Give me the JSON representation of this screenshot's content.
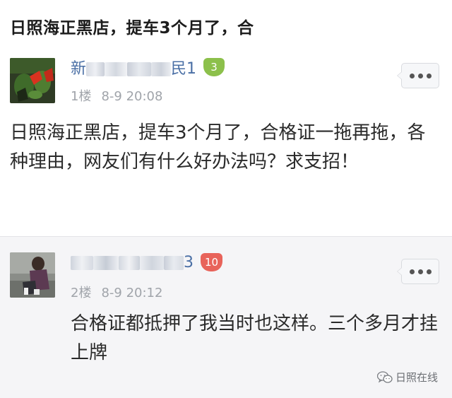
{
  "thread": {
    "title": "日照海正黑店，提车3个月了，合"
  },
  "posts": [
    {
      "username_start": "新",
      "username_end": "民1",
      "level": "3",
      "floor": "1楼",
      "time": "8-9 20:08",
      "body": "日照海正黑店，提车3个月了，合格证一拖再拖，各种理由，网友们有什么好办法吗？求支招！"
    },
    {
      "username_start": "",
      "username_end": "3",
      "level": "10",
      "floor": "2楼",
      "time": "8-9 20:12",
      "body": "合格证都抵押了我当时也这样。三个多月才挂上牌"
    }
  ],
  "watermark": {
    "label": "日照在线",
    "icon": "wechat-icon"
  },
  "colors": {
    "username": "#4a6fa5",
    "badge_green": "#8cc04b",
    "badge_red": "#e8635a",
    "meta": "#a0a4aa"
  }
}
